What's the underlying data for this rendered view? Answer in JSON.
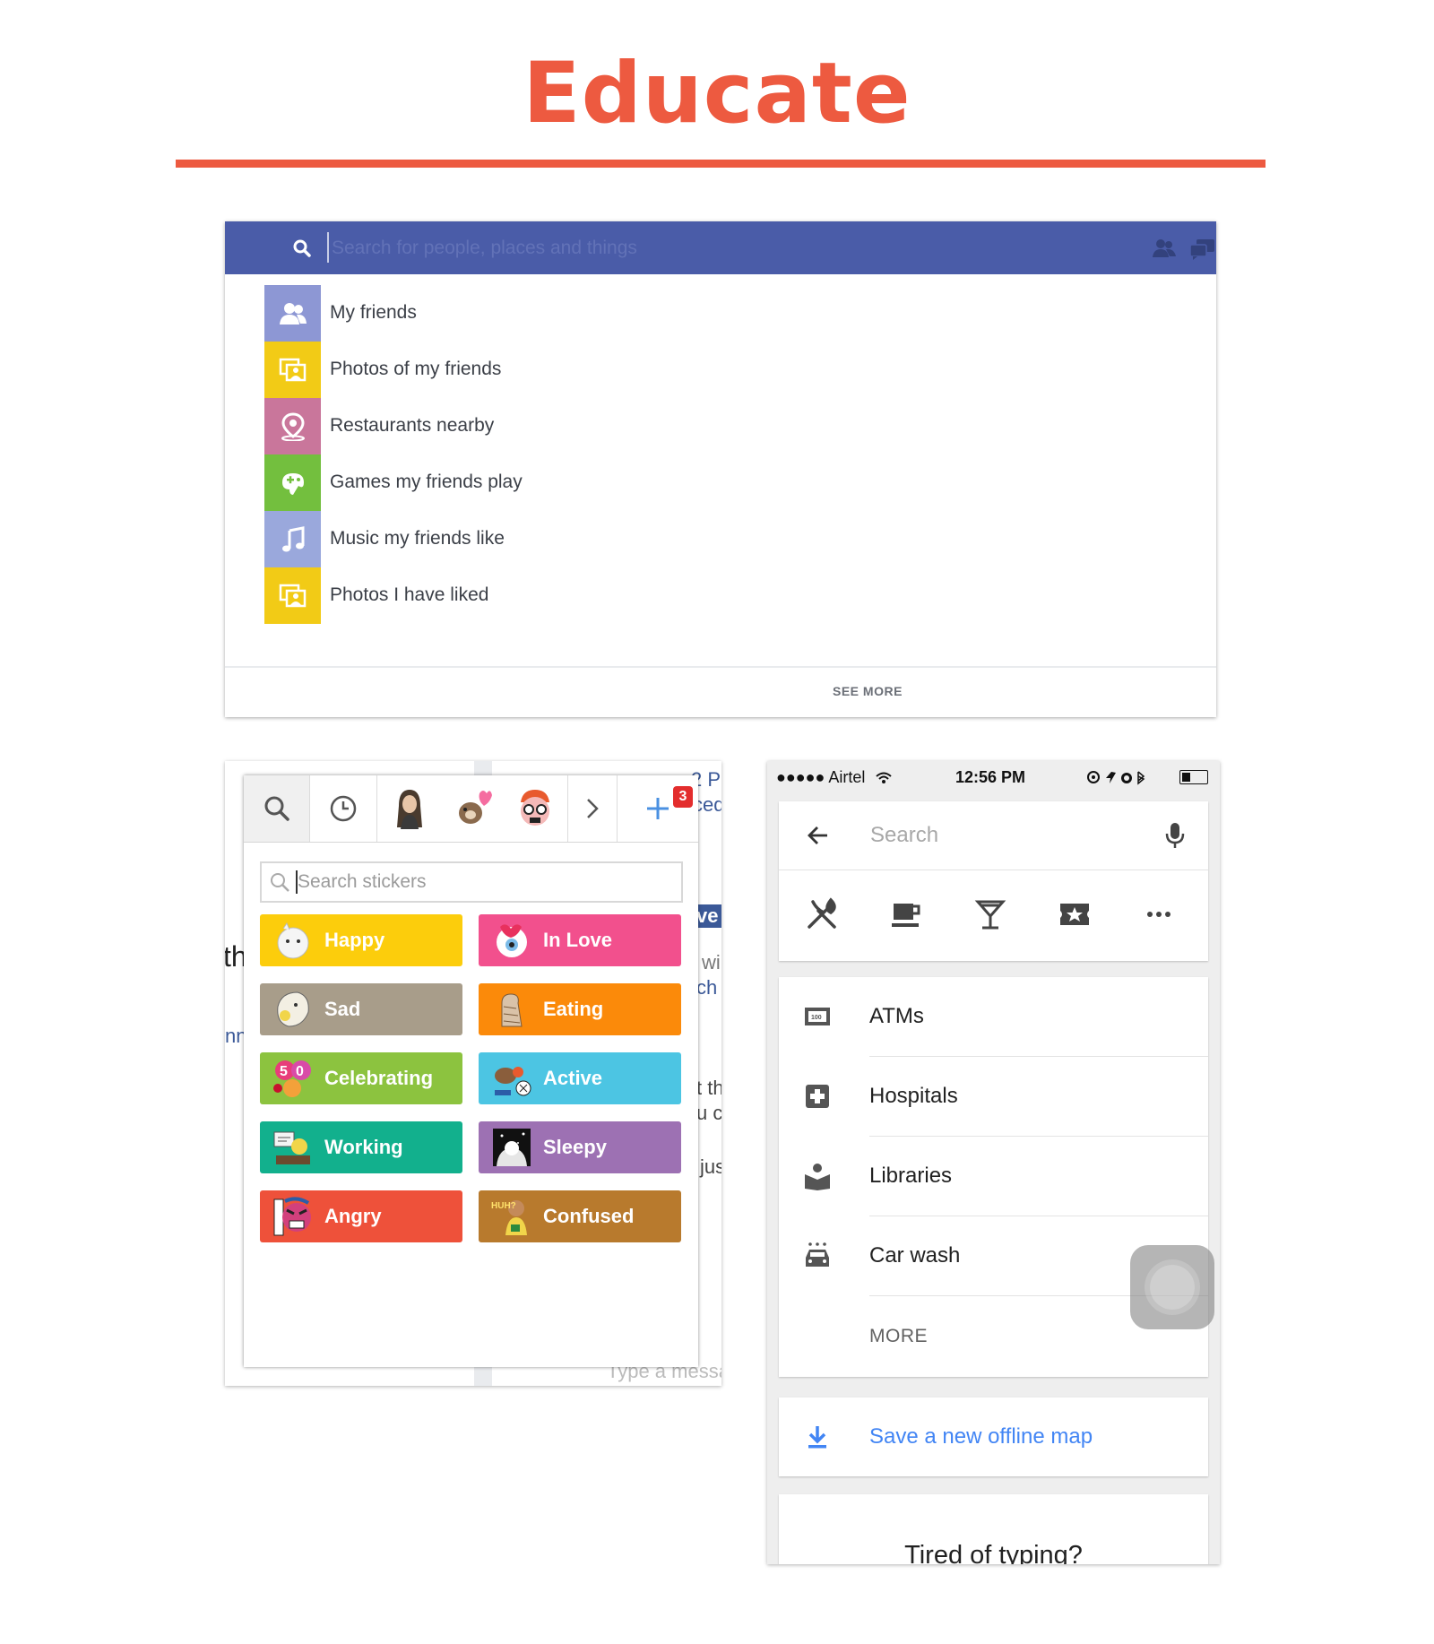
{
  "heading": {
    "title": "Educate",
    "accent": "#ed5a40"
  },
  "facebook": {
    "search_placeholder": "Search for people, places and things",
    "bar_color": "#4a5ca8",
    "suggestions": [
      {
        "label": "My friends",
        "icon": "friends-icon",
        "color": "#8d97d4"
      },
      {
        "label": "Photos of my friends",
        "icon": "photos-icon",
        "color": "#f2cb16"
      },
      {
        "label": "Restaurants nearby",
        "icon": "map-pin-icon",
        "color": "#c9769b"
      },
      {
        "label": "Games my friends play",
        "icon": "game-controller-icon",
        "color": "#73bf3e"
      },
      {
        "label": "Music my friends like",
        "icon": "music-note-icon",
        "color": "#9aa8dc"
      },
      {
        "label": "Photos I have liked",
        "icon": "photos-icon",
        "color": "#f2cb16"
      }
    ],
    "see_more": "SEE MORE"
  },
  "stickers": {
    "search_placeholder": "Search stickers",
    "badge_count": "3",
    "moods": [
      {
        "label": "Happy",
        "color": "#fccd0c"
      },
      {
        "label": "In Love",
        "color": "#f2508d"
      },
      {
        "label": "Sad",
        "color": "#a89d8a"
      },
      {
        "label": "Eating",
        "color": "#fb8a0a"
      },
      {
        "label": "Celebrating",
        "color": "#8cc33f"
      },
      {
        "label": "Active",
        "color": "#4cc5e3"
      },
      {
        "label": "Working",
        "color": "#12b08d"
      },
      {
        "label": "Sleepy",
        "color": "#9d71b3"
      },
      {
        "label": "Angry",
        "color": "#ee513a"
      },
      {
        "label": "Confused",
        "color": "#b87a2d"
      }
    ],
    "background_snippets": [
      "2 P",
      "ced",
      "ve",
      "wi",
      "ch",
      "th",
      "nn",
      "t th",
      "u c",
      "jus",
      "Type a messa"
    ]
  },
  "maps": {
    "status": {
      "carrier": "●●●●● Airtel",
      "time": "12:56 PM"
    },
    "search_placeholder": "Search",
    "categories": [
      "restaurants-icon",
      "coffee-icon",
      "bars-icon",
      "events-icon",
      "more-options-icon"
    ],
    "places": [
      {
        "label": "ATMs",
        "icon": "atm-icon"
      },
      {
        "label": "Hospitals",
        "icon": "hospital-icon"
      },
      {
        "label": "Libraries",
        "icon": "library-icon"
      },
      {
        "label": "Car wash",
        "icon": "car-wash-icon"
      }
    ],
    "more": "MORE",
    "offline": "Save a new offline map",
    "tired": "Tired of typing?"
  }
}
